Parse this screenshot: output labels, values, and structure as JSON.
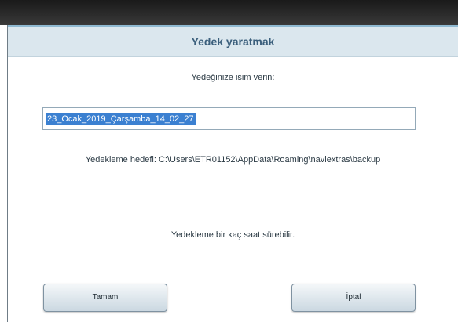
{
  "dialog": {
    "title": "Yedek yaratmak",
    "prompt": "Yedeğinize isim verin:",
    "name_value": "23_Ocak_2019_Çarşamba_14_02_27",
    "target_label": "Yedekleme hedefi: C:\\Users\\ETR01152\\AppData\\Roaming\\naviextras\\backup",
    "duration_note": "Yedekleme bir kaç saat sürebilir.",
    "ok_label": "Tamam",
    "cancel_label": "İptal"
  }
}
